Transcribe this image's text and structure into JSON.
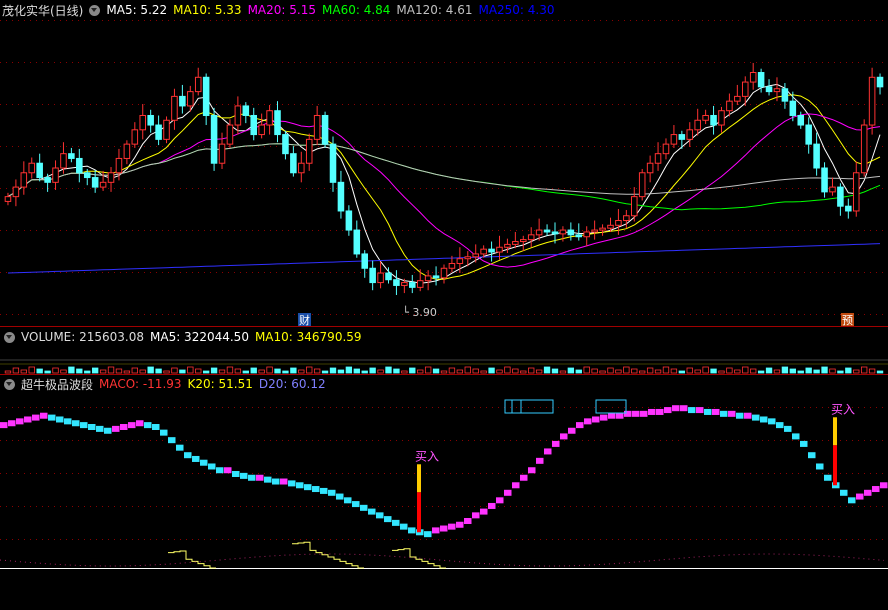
{
  "price_panel": {
    "stock_name": "茂化实华(日线)",
    "indicators": [
      {
        "label": "MA5: 5.22",
        "color": "#ffffff"
      },
      {
        "label": "MA10: 5.33",
        "color": "#ffff00"
      },
      {
        "label": "MA20: 5.15",
        "color": "#ff00ff"
      },
      {
        "label": "MA60: 4.84",
        "color": "#00ff00"
      },
      {
        "label": "MA120: 4.61",
        "color": "#c0c0c0"
      },
      {
        "label": "MA250: 4.30",
        "color": "#0000ff"
      }
    ],
    "low_marker": "3.90",
    "event_badge_left": "财",
    "event_badge_right": "预"
  },
  "volume_panel": {
    "title": "VOLUME: 215603.08",
    "indicators": [
      {
        "label": "MA5: 322044.50",
        "color": "#ffffff"
      },
      {
        "label": "MA10: 346790.59",
        "color": "#ffff00"
      }
    ]
  },
  "indicator_panel": {
    "title": "超牛极品波段",
    "indicators": [
      {
        "label": "MACO: -11.93",
        "color": "#ff3333"
      },
      {
        "label": "K20: 51.51",
        "color": "#ffff00"
      },
      {
        "label": "D20: 60.12",
        "color": "#8080ff"
      }
    ],
    "buy_labels": [
      "买入",
      "买入"
    ]
  },
  "chart_data": [
    {
      "type": "candlestick",
      "title": "茂化实华(日线)",
      "y_range": [
        3.6,
        6.7
      ],
      "low_point": 3.9,
      "close": [
        4.85,
        4.95,
        5.1,
        5.2,
        5.05,
        5.0,
        5.15,
        5.3,
        5.25,
        5.1,
        5.05,
        4.95,
        5.0,
        5.1,
        5.25,
        5.4,
        5.55,
        5.7,
        5.6,
        5.45,
        5.65,
        5.9,
        5.8,
        5.95,
        6.1,
        5.7,
        5.2,
        5.4,
        5.6,
        5.8,
        5.7,
        5.5,
        5.6,
        5.75,
        5.5,
        5.3,
        5.1,
        5.2,
        5.45,
        5.7,
        5.4,
        5.0,
        4.7,
        4.5,
        4.25,
        4.1,
        3.95,
        4.05,
        3.98,
        3.92,
        3.95,
        3.9,
        3.97,
        4.02,
        4.0,
        4.1,
        4.15,
        4.2,
        4.22,
        4.25,
        4.3,
        4.27,
        4.32,
        4.35,
        4.38,
        4.4,
        4.45,
        4.5,
        4.48,
        4.46,
        4.5,
        4.45,
        4.43,
        4.48,
        4.5,
        4.52,
        4.55,
        4.6,
        4.65,
        4.85,
        5.1,
        5.2,
        5.3,
        5.4,
        5.5,
        5.45,
        5.55,
        5.65,
        5.7,
        5.6,
        5.75,
        5.85,
        5.9,
        6.05,
        6.15,
        6.0,
        5.95,
        5.98,
        5.85,
        5.7,
        5.6,
        5.4,
        5.15,
        4.9,
        4.95,
        4.75,
        4.7,
        5.1,
        5.6,
        6.1,
        6.0
      ],
      "ma_series": [
        "MA5",
        "MA10",
        "MA20",
        "MA60",
        "MA120",
        "MA250"
      ]
    },
    {
      "type": "bar",
      "title": "VOLUME",
      "values": [
        215603.08
      ],
      "ma": {
        "MA5": 322044.5,
        "MA10": 346790.59
      }
    },
    {
      "type": "bar",
      "title": "超牛极品波段",
      "y_range": [
        0,
        100
      ],
      "series": [
        {
          "name": "K20",
          "values": [
            76,
            77,
            78,
            79,
            80,
            81,
            80,
            79,
            78,
            77,
            76,
            75,
            74,
            73,
            74,
            75,
            76,
            77,
            76,
            75,
            72,
            68,
            64,
            60,
            58,
            56,
            54,
            52,
            52,
            50,
            49,
            48,
            48,
            47,
            46,
            46,
            45,
            44,
            43,
            42,
            41,
            40,
            38,
            36,
            34,
            32,
            30,
            28,
            26,
            24,
            22,
            20,
            19,
            18,
            20,
            21,
            22,
            23,
            25,
            28,
            30,
            33,
            36,
            40,
            44,
            48,
            52,
            57,
            62,
            66,
            70,
            73,
            76,
            78,
            79,
            80,
            81,
            81,
            82,
            82,
            82,
            83,
            83,
            84,
            85,
            85,
            84,
            84,
            83,
            83,
            82,
            82,
            81,
            81,
            80,
            79,
            78,
            76,
            74,
            70,
            66,
            60,
            54,
            48,
            44,
            40,
            36,
            38,
            40,
            42,
            44
          ]
        },
        {
          "name": "D20",
          "values": [
            60.12
          ]
        },
        {
          "name": "MACO",
          "values": [
            -11.93
          ]
        }
      ],
      "buy_signals": [
        "买入",
        "买入"
      ]
    }
  ]
}
